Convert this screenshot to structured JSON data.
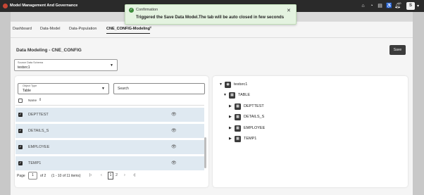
{
  "app": {
    "title": "Model Management And Governance",
    "user_initial": "S",
    "notification_count": "10"
  },
  "tabs": [
    {
      "label": "Dashboard"
    },
    {
      "label": "Data-Model"
    },
    {
      "label": "Data-Population"
    },
    {
      "label": "CNE_CONFIG-Modeling",
      "active": true,
      "close": "×"
    }
  ],
  "page": {
    "title": "Data Modeling - CNE_CONFIG",
    "save_label": "Save"
  },
  "schema": {
    "label": "Source Data Schema",
    "value": "testsrc1"
  },
  "object_type": {
    "label": "Object Type",
    "value": "Table"
  },
  "search": {
    "placeholder": "Search"
  },
  "table": {
    "name_header": "Name",
    "rows": [
      {
        "name": "DEPTTEST",
        "checked": true
      },
      {
        "name": "DETAILS_S",
        "checked": true
      },
      {
        "name": "EMPLOYEE",
        "checked": true
      },
      {
        "name": "TEMP1",
        "checked": true
      }
    ]
  },
  "pager": {
    "page_label": "Page",
    "current_page": "1",
    "of_label": "of 2",
    "range_label": "(1 - 10 of 11 items)",
    "pages": [
      "1",
      "2"
    ]
  },
  "tree": {
    "root": "testsrc1",
    "group": "TABLE",
    "items": [
      "DEPTTEST",
      "DETAILS_S",
      "EMPLOYEE",
      "TEMP1"
    ]
  },
  "toast": {
    "title": "Confirmation",
    "message": "Triggered the Save Data Model.The tab will be auto closed in few seconds"
  },
  "colors": {
    "topbar": "#2a2a2a",
    "row_selected": "#dfe9f1",
    "toast_bg": "#e4f3e0",
    "success": "#3c8b3a"
  }
}
